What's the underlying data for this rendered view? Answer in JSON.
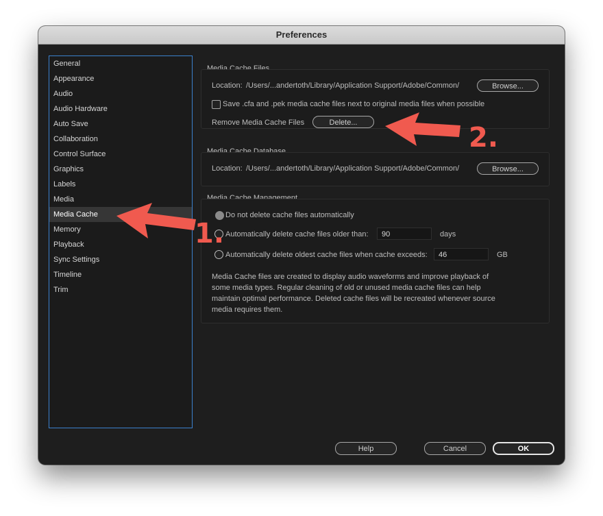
{
  "window": {
    "title": "Preferences"
  },
  "sidebar": {
    "items": [
      {
        "label": "General"
      },
      {
        "label": "Appearance"
      },
      {
        "label": "Audio"
      },
      {
        "label": "Audio Hardware"
      },
      {
        "label": "Auto Save"
      },
      {
        "label": "Collaboration"
      },
      {
        "label": "Control Surface"
      },
      {
        "label": "Graphics"
      },
      {
        "label": "Labels"
      },
      {
        "label": "Media"
      },
      {
        "label": "Media Cache",
        "selected": true
      },
      {
        "label": "Memory"
      },
      {
        "label": "Playback"
      },
      {
        "label": "Sync Settings"
      },
      {
        "label": "Timeline"
      },
      {
        "label": "Trim"
      }
    ]
  },
  "cache_files": {
    "title": "Media Cache Files",
    "location_label": "Location:",
    "location_path": "/Users/...andertoth/Library/Application Support/Adobe/Common/",
    "browse_label": "Browse...",
    "save_checkbox_label": "Save .cfa and .pek media cache files next to original media files when possible",
    "remove_label": "Remove Media Cache Files",
    "delete_label": "Delete..."
  },
  "cache_db": {
    "title": "Media Cache Database",
    "location_label": "Location:",
    "location_path": "/Users/...andertoth/Library/Application Support/Adobe/Common/",
    "browse_label": "Browse..."
  },
  "management": {
    "title": "Media Cache Management",
    "option_no_delete": "Do not delete cache files automatically",
    "option_older": "Automatically delete cache files older than:",
    "older_value": "90",
    "older_unit": "days",
    "option_exceeds": "Automatically delete oldest cache files when cache exceeds:",
    "exceeds_value": "46",
    "exceeds_unit": "GB",
    "description": "Media Cache files are created to display audio waveforms and improve playback of some media types.  Regular cleaning of old or unused media cache files can help maintain optimal performance. Deleted cache files will be recreated whenever source media requires them."
  },
  "footer": {
    "help_label": "Help",
    "cancel_label": "Cancel",
    "ok_label": "OK"
  },
  "annotations": {
    "step1": "1.",
    "step2": "2.",
    "arrow_color": "#f05a4f"
  }
}
